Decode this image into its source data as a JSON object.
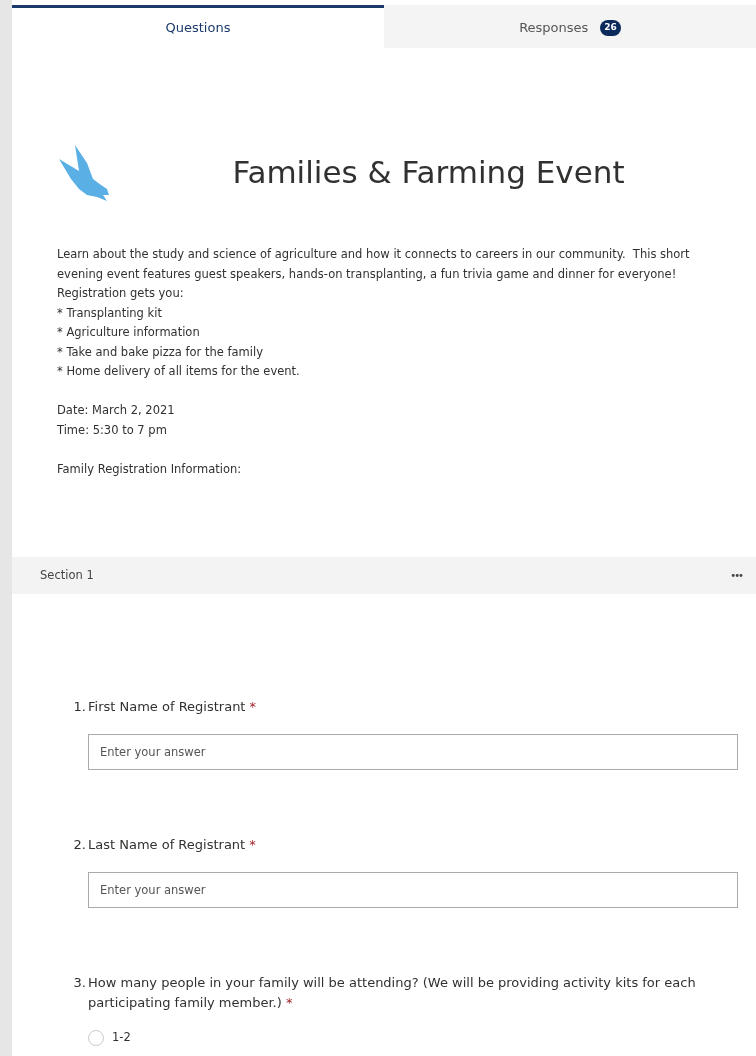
{
  "tabs": [
    {
      "label": "Questions",
      "selected": true
    },
    {
      "label": "Responses",
      "selected": false,
      "badge": "26"
    }
  ],
  "form": {
    "title": "Families & Farming Event",
    "description": [
      [
        "Learn about the study and science of agriculture and how it connects to careers in our community.  This short",
        "evening event features guest speakers, hands-on transplanting, a fun trivia game and dinner for everyone!",
        "Registration gets you:",
        "* Transplanting kit",
        "* Agriculture information",
        "* Take and bake pizza for the family",
        "* Home delivery of all items for the event."
      ],
      [
        "Date: March 2, 2021",
        "Time: 5:30 to 7 pm"
      ],
      [
        "Family Registration Information:"
      ]
    ]
  },
  "section": {
    "title": "Section 1",
    "menu": "•••"
  },
  "questions": [
    {
      "number": "1.",
      "text": "First Name of Registrant",
      "required_mark": "*",
      "kind": "text",
      "placeholder": "Enter your answer"
    },
    {
      "number": "2.",
      "text": "Last Name of Registrant",
      "required_mark": "*",
      "kind": "text",
      "placeholder": "Enter your answer"
    },
    {
      "number": "3.",
      "text": "How many people in your family will be attending?  (We will be providing activity kits for each participating family member.)",
      "required_mark": "*",
      "kind": "choice",
      "options": [
        {
          "label": "1-2",
          "selected": false
        }
      ]
    }
  ]
}
